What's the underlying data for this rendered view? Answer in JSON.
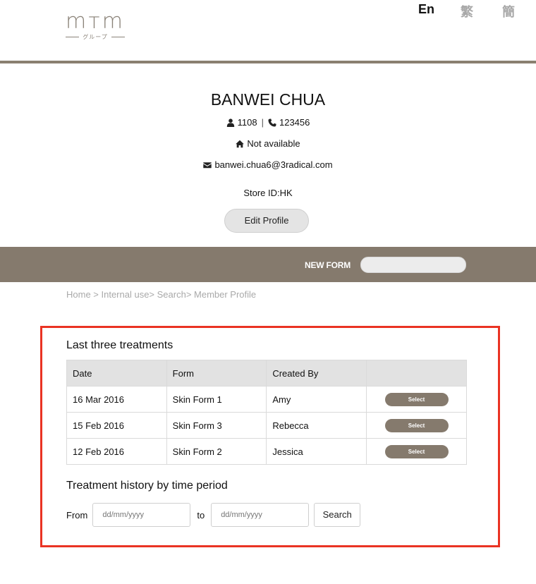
{
  "header": {
    "logo_text": "mтm",
    "logo_sub": "グループ",
    "languages": [
      "En",
      "繁",
      "簡"
    ]
  },
  "profile": {
    "name": "BANWEI CHUA",
    "member_no": "1108",
    "phone": "123456",
    "address": "Not available",
    "email": "banwei.chua6@3radical.com",
    "store": "Store ID:HK",
    "edit_label": "Edit Profile"
  },
  "form_bar": {
    "label": "NEW FORM",
    "select_value": ""
  },
  "breadcrumb": "Home > Internal use> Search> Member Profile",
  "treatments": {
    "title": "Last three treatments",
    "headers": [
      "Date",
      "Form",
      "Created By",
      ""
    ],
    "rows": [
      {
        "date": "16 Mar 2016",
        "form": "Skin Form 1",
        "created_by": "Amy",
        "action": "Select"
      },
      {
        "date": "15 Feb 2016",
        "form": "Skin Form 3",
        "created_by": "Rebecca",
        "action": "Select"
      },
      {
        "date": "12 Feb 2016",
        "form": "Skin Form 2",
        "created_by": "Jessica",
        "action": "Select"
      }
    ]
  },
  "history": {
    "title": "Treatment history by time period",
    "from_label": "From",
    "to_label": "to",
    "from_placeholder": "dd/mm/yyyy",
    "to_placeholder": "dd/mm/yyyy",
    "search_label": "Search"
  },
  "colors": {
    "brand": "#857a6d",
    "highlight": "#ea3323"
  },
  "icons": [
    "user-icon",
    "phone-icon",
    "home-icon",
    "envelope-icon"
  ]
}
